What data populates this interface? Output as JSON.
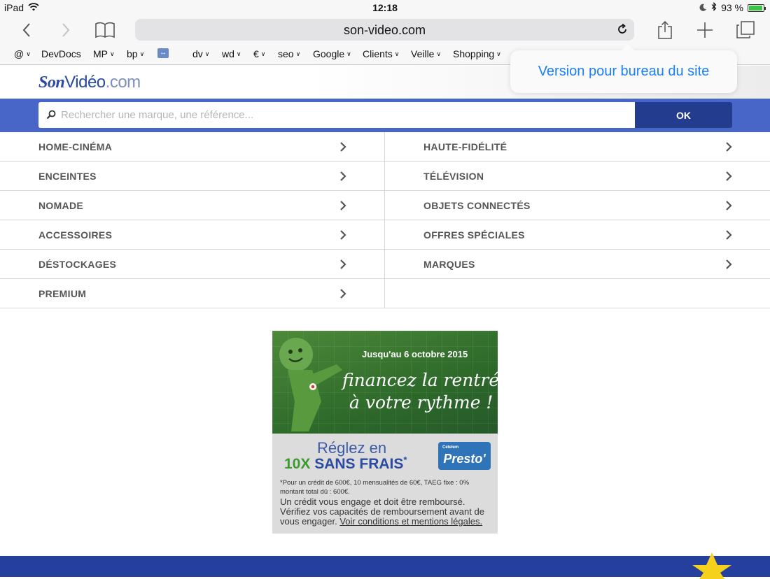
{
  "status_bar": {
    "device": "iPad",
    "time": "12:18",
    "battery": "93 %",
    "battery_level": 0.93
  },
  "browser": {
    "url": "son-video.com",
    "favorites": [
      {
        "label": "@",
        "has_menu": true
      },
      {
        "label": "DevDocs",
        "has_menu": false
      },
      {
        "label": "MP",
        "has_menu": true
      },
      {
        "label": "bp",
        "has_menu": true
      },
      {
        "label": "↔",
        "has_menu": false
      },
      {
        "label": "dv",
        "has_menu": true
      },
      {
        "label": "wd",
        "has_menu": true
      },
      {
        "label": "€",
        "has_menu": true
      },
      {
        "label": "seo",
        "has_menu": true
      },
      {
        "label": "Google",
        "has_menu": true
      },
      {
        "label": "Clients",
        "has_menu": true
      },
      {
        "label": "Veille",
        "has_menu": true
      },
      {
        "label": "Shopping",
        "has_menu": true
      }
    ],
    "popover": {
      "label": "Version pour bureau du site"
    }
  },
  "site": {
    "logo": {
      "part1": "Son",
      "part2": "Vidéo",
      "part3": ".com"
    },
    "search": {
      "placeholder": "Rechercher une marque, une référence...",
      "button": "OK"
    },
    "menu": {
      "left": [
        "HOME-CINÉMA",
        "ENCEINTES",
        "NOMADE",
        "ACCESSOIRES",
        "DÉSTOCKAGES",
        "PREMIUM"
      ],
      "right": [
        "HAUTE-FIDÉLITÉ",
        "TÉLÉVISION",
        "OBJETS CONNECTÉS",
        "OFFRES SPÉCIALES",
        "MARQUES"
      ]
    },
    "ad": {
      "date": "Jusqu'au 6 octobre 2015",
      "headline_line1": "financez la rentrée",
      "headline_line2": "à votre rythme !",
      "offer_line1": "Réglez en",
      "offer_10x": "10X",
      "offer_sans_frais": "SANS FRAIS",
      "offer_star": "*",
      "brand_small": "Cetelem",
      "brand": "Presto'",
      "fine_print_line1": "*Pour un crédit de 600€, 10 mensualités de 60€, TAEG fixe : 0%",
      "fine_print_line2": "montant total dû : 600€.",
      "legal_text": "Un crédit vous engage et doit être remboursé. Vérifiez vos capacités de remboursement avant de vous engager.",
      "legal_link": "Voir conditions et mentions légales."
    }
  },
  "colors": {
    "ios_blue": "#1a7ffb",
    "search_band": "#4866c8",
    "ok_button": "#243c8e",
    "footer_band": "#243f9e",
    "menu_text": "#555555"
  }
}
